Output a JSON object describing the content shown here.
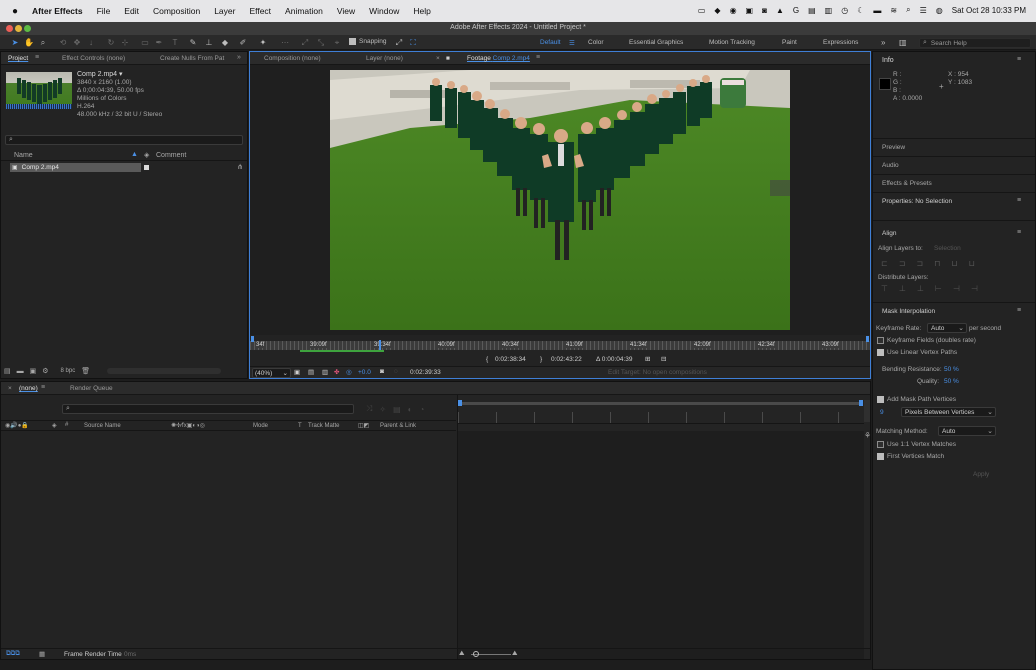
{
  "menubar": {
    "apple": "",
    "app": "After Effects",
    "items": [
      "File",
      "Edit",
      "Composition",
      "Layer",
      "Effect",
      "Animation",
      "View",
      "Window",
      "Help"
    ],
    "datetime": "Sat Oct 28  10:33 PM"
  },
  "window": {
    "title": "Adobe After Effects 2024 - Untitled Project *"
  },
  "toolbar": {
    "snapping": "Snapping",
    "workspaces": [
      "Default",
      "Color",
      "Essential Graphics",
      "Motion Tracking",
      "Paint",
      "Expressions"
    ],
    "search_placeholder": "Search Help"
  },
  "project": {
    "tabs": {
      "project": "Project",
      "effect_controls": "Effect Controls (none)",
      "nulls": "Create Nulls From Pat"
    },
    "file": {
      "name": "Comp 2.mp4 ▾",
      "lines": [
        "3840 x 2160 (1.00)",
        "Δ 0;00:04:39, 50.00 fps",
        "Millions of Colors",
        "H.264",
        "48.000 kHz / 32 bit U / Stereo"
      ]
    },
    "search_placeholder": "",
    "columns": {
      "name": "Name",
      "comment": "Comment"
    },
    "items": [
      {
        "name": "Comp 2.mp4"
      }
    ],
    "bpc": "8 bpc"
  },
  "viewer": {
    "tabs": {
      "composition": "Composition (none)",
      "layer": "Layer (none)",
      "footage_prefix": "Footage",
      "footage_name": "Comp 2.mp4"
    },
    "ruler": [
      "34f",
      "39:09f",
      "39:34f",
      "40:09f",
      "40:34f",
      "41:09f",
      "41:34f",
      "42:09f",
      "42:34f",
      "43:09f"
    ],
    "in_point": "0:02:38:34",
    "out_point": "0:02:43:22",
    "duration": "Δ 0:00:04:39",
    "zoom": "(40%)",
    "exposure": "+0.0",
    "current_time": "0:02:39:33",
    "edit_target": "Edit Target: No open compositions"
  },
  "timeline": {
    "tab_none": "(none)",
    "tab_render": "Render Queue",
    "columns": {
      "source": "Source Name",
      "mode": "Mode",
      "t": "T",
      "matte": "Track Matte",
      "parent": "Parent & Link"
    },
    "status": "Frame Render Time",
    "status_value": "0ms"
  },
  "info": {
    "title": "Info",
    "r": "R :",
    "g": "G :",
    "b": "B :",
    "a": "A :  0.0000",
    "x": "X : 954",
    "y": "Y : 1083"
  },
  "right_panels": {
    "preview": "Preview",
    "audio": "Audio",
    "effects": "Effects & Presets",
    "properties": "Properties: No Selection",
    "align": "Align",
    "align_to_label": "Align Layers to:",
    "align_to_value": "Selection",
    "distribute": "Distribute Layers:",
    "mask": "Mask Interpolation",
    "keyframe_rate_label": "Keyframe Rate:",
    "keyframe_rate_value": "Auto",
    "per_second": "per second",
    "keyframe_fields": "Keyframe Fields (doubles rate)",
    "linear_vertex": "Use Linear Vertex Paths",
    "bending_label": "Bending Resistance:",
    "bending_value": "50 %",
    "quality_label": "Quality:",
    "quality_value": "50 %",
    "add_vertices": "Add Mask Path Vertices",
    "vertices_value": "9",
    "vertices_unit": "Pixels Between Vertices",
    "matching_label": "Matching Method:",
    "matching_value": "Auto",
    "one_to_one": "Use 1:1 Vertex Matches",
    "first_vertices": "First Vertices Match",
    "apply": "Apply"
  },
  "colors": {
    "accent": "#4a90e6",
    "grass": "#3f7a1e",
    "blazer": "#0f3b26"
  }
}
